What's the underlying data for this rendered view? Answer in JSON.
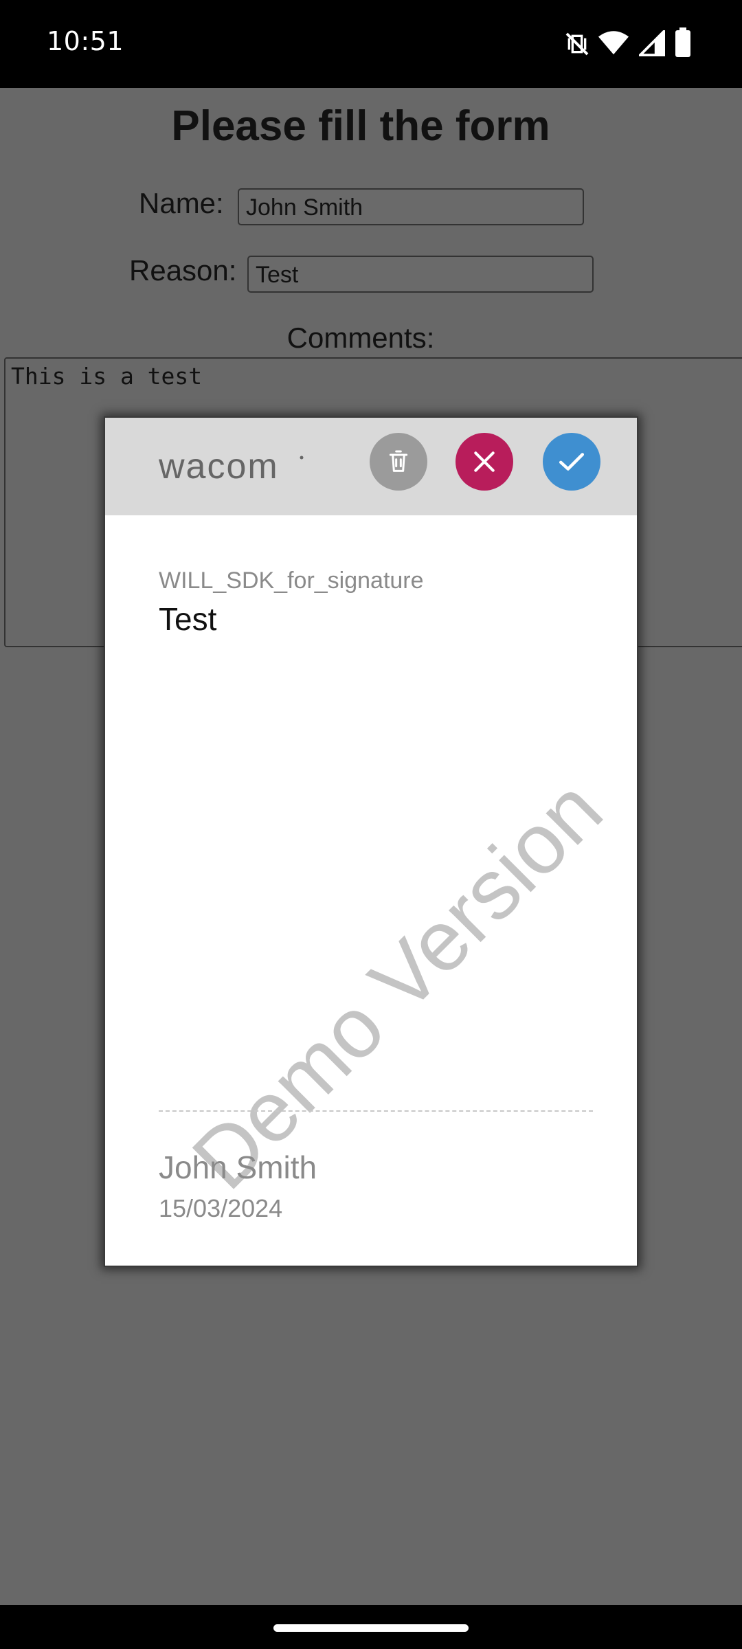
{
  "status_bar": {
    "time": "10:51",
    "icons": [
      "vibrate-off-icon",
      "wifi-icon",
      "signal-icon",
      "battery-icon"
    ]
  },
  "form": {
    "title": "Please fill the form",
    "name_label": "Name:",
    "name_value": "John Smith",
    "reason_label": "Reason:",
    "reason_value": "Test",
    "comments_label": "Comments:",
    "comments_value": "This is a test"
  },
  "dialog": {
    "logo_text": "wacom",
    "buttons": {
      "clear": "trash-icon",
      "cancel": "close-icon",
      "ok": "check-icon"
    },
    "colors": {
      "clear": "#9b9b9b",
      "cancel": "#b81d5b",
      "ok": "#3f8fd0"
    },
    "document_name": "WILL_SDK_for_signature",
    "reason": "Test",
    "watermark": "Demo Version",
    "signer_name": "John Smith",
    "date": "15/03/2024"
  }
}
